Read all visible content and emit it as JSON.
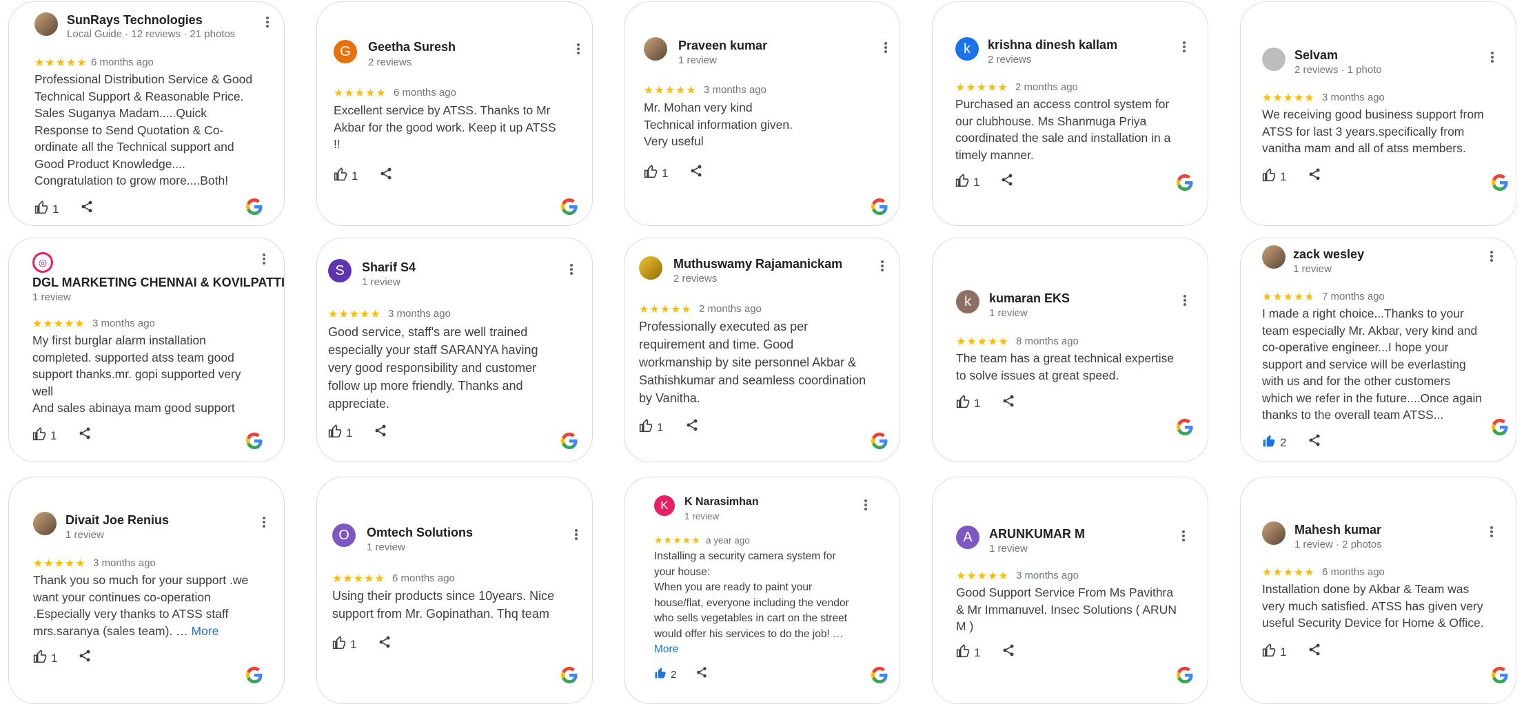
{
  "colors": {
    "star": "#fbbc04",
    "link": "#1a73e8",
    "like_active": "#1a73e8",
    "border": "#dadce0"
  },
  "icons": {
    "menu": "more-vert-icon",
    "like": "thumbs-up-icon",
    "share": "share-icon",
    "source": "google-logo-icon"
  },
  "reviews": [
    {
      "name": "SunRays Technologies",
      "meta": "Local Guide · 12 reviews · 21 photos",
      "rating": 5,
      "stars": "★★★★★",
      "date": "6 months ago",
      "text": "Professional Distribution Service & Good\nTechnical Support & Reasonable Price.\nSales Suganya Madam.....Quick\nResponse to Send Quotation & Co-\nordinate all the Technical support and\nGood Product Knowledge....\nCongratulation to grow more....Both!",
      "likes": "1",
      "avatar": "photo"
    },
    {
      "name": "Geetha Suresh",
      "meta": "2 reviews",
      "rating": 5,
      "stars": "★★★★★",
      "date": "6 months ago",
      "text": "Excellent service by ATSS. Thanks to Mr\nAkbar for the good work. Keep it up ATSS\n!!",
      "likes": "1",
      "avatar": "G",
      "avatar_color": "#e8710a"
    },
    {
      "name": "Praveen kumar",
      "meta": "1 review",
      "rating": 5,
      "stars": "★★★★★",
      "date": "3 months ago",
      "text": "Mr. Mohan very kind\nTechnical information given.\nVery useful",
      "likes": "1",
      "avatar": "photo"
    },
    {
      "name": "krishna dinesh kallam",
      "meta": "2 reviews",
      "rating": 5,
      "stars": "★★★★★",
      "date": "2 months ago",
      "text": "Purchased an access control system for\nour clubhouse. Ms Shanmuga Priya\ncoordinated the sale and installation in a\ntimely manner.",
      "likes": "1",
      "avatar": "k",
      "avatar_color": "#1a73e8"
    },
    {
      "name": "Selvam",
      "meta": "2 reviews · 1 photo",
      "rating": 5,
      "stars": "★★★★★",
      "date": "3 months ago",
      "text": "We receiving good business support from\nATSS for last 3 years.specifically from\nvanitha mam and all of atss members.",
      "likes": "1",
      "avatar": "",
      "avatar_color": "#bdbdbd"
    },
    {
      "name": "DGL MARKETING CHENNAI & KOVILPATTI.",
      "meta": "1 review",
      "rating": 5,
      "stars": "★★★★★",
      "date": "3 months ago",
      "text": "My first  burglar  alarm  installation\ncompleted. supported atss team good\nsupport thanks.mr. gopi supported very\nwell\nAnd sales  abinaya  mam good support",
      "likes": "1",
      "avatar": "logo"
    },
    {
      "name": "Sharif S4",
      "meta": "1 review",
      "rating": 5,
      "stars": "★★★★★",
      "date": "3 months ago",
      "text": "Good service,  staff's are well trained\nespecially your staff  SARANYA having\nvery good responsibility and customer\nfollow up more friendly. Thanks and\nappreciate.",
      "likes": "1",
      "avatar": "S",
      "avatar_color": "#5e35b1"
    },
    {
      "name": "Muthuswamy Rajamanickam",
      "meta": "2 reviews",
      "rating": 5,
      "stars": "★★★★★",
      "date": "2 months ago",
      "text": "Professionally executed as per\nrequirement and time. Good\nworkmanship by site personnel Akbar &\nSathishkumar and seamless coordination\nby Vanitha.",
      "likes": "1",
      "avatar": "photo"
    },
    {
      "name": "kumaran EKS",
      "meta": "1 review",
      "rating": 5,
      "stars": "★★★★★",
      "date": "8 months ago",
      "text": "The team has a great technical expertise\nto solve issues at great speed.",
      "likes": "1",
      "avatar": "k",
      "avatar_color": "#8d6e63"
    },
    {
      "name": "zack wesley",
      "meta": "1 review",
      "rating": 5,
      "stars": "★★★★★",
      "date": "7 months ago",
      "text": "I made a right choice...Thanks to your\nteam especially Mr. Akbar, very kind and\nco-operative engineer...I hope your\nsupport and service will be everlasting\nwith us and for the other customers\nwhich we refer in the future....Once again\nthanks to the overall team ATSS...",
      "likes": "2",
      "liked": true,
      "avatar": "photo"
    },
    {
      "name": "Divait Joe Renius",
      "meta": "1 review",
      "rating": 5,
      "stars": "★★★★★",
      "date": "3 months ago",
      "text": "Thank  you so much for your support .we\nwant your continues co-operation\n.Especially very thanks to ATSS  staff\nmrs.saranya (sales team). … ",
      "more": "More",
      "likes": "1",
      "avatar": "photo"
    },
    {
      "name": "Omtech Solutions",
      "meta": "1 review",
      "rating": 5,
      "stars": "★★★★★",
      "date": "6 months ago",
      "text": "Using their products since 10years. Nice\nsupport from Mr. Gopinathan. Thq team",
      "likes": "1",
      "avatar": "O",
      "avatar_color": "#7e57c2"
    },
    {
      "name": "K Narasimhan",
      "meta": "1 review",
      "rating": 5,
      "stars": "★★★★★",
      "date": "a year ago",
      "text": "Installing a security camera system for\nyour house:\nWhen you are ready to paint your\nhouse/flat, everyone including the vendor\nwho sells vegetables in cart on the street\nwould offer his services to do the job! …\n",
      "more": "More",
      "likes": "2",
      "liked": true,
      "avatar": "K",
      "avatar_color": "#e91e63"
    },
    {
      "name": "ARUNKUMAR M",
      "meta": "1 review",
      "rating": 5,
      "stars": "★★★★★",
      "date": "3 months ago",
      "text": "Good Support Service From Ms Pavithra\n& Mr Immanuvel. Insec Solutions  ( ARUN\nM )",
      "likes": "1",
      "avatar": "A",
      "avatar_color": "#7e57c2"
    },
    {
      "name": "Mahesh kumar",
      "meta": "1 review · 2 photos",
      "rating": 5,
      "stars": "★★★★★",
      "date": "6 months ago",
      "text": "Installation done by Akbar & Team was\nvery much satisfied. ATSS has given very\nuseful Security Device for Home & Office.",
      "likes": "1",
      "avatar": "photo"
    }
  ]
}
